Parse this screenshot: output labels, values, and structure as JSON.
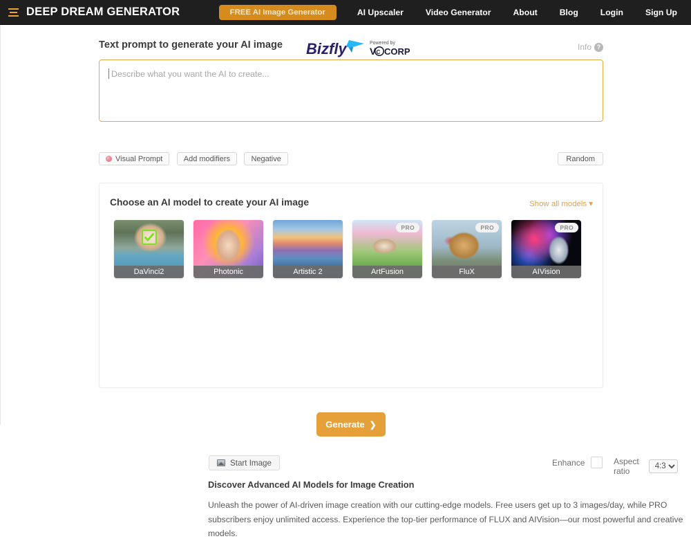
{
  "nav": {
    "menu_icon": "hamburger-icon",
    "brand": "DEEP DREAM GENERATOR",
    "cta": "FREE AI Image Generator",
    "links": [
      {
        "label": "AI Upscaler"
      },
      {
        "label": "Video Generator"
      },
      {
        "label": "About"
      },
      {
        "label": "Blog"
      },
      {
        "label": "Login"
      },
      {
        "label": "Sign Up"
      }
    ],
    "cta_color": "#d68c1c",
    "bar_color": "#1f1f1f"
  },
  "prompt": {
    "title": "Text prompt to generate your AI image",
    "placeholder": "Describe what you want the AI to create...",
    "value": "",
    "info_label": "Info",
    "info_icon": "question-mark-icon",
    "border_color": "#e0a94a",
    "sponsor": {
      "brand": "Bizfly",
      "powered_by": "Powered by",
      "parent": "CCORP",
      "parent_prefix": "V",
      "brand_color": "#2b1f6b",
      "accent_color": "#29b6f6"
    },
    "tools": [
      {
        "label": "Visual Prompt",
        "icon": "visual-prompt-icon"
      },
      {
        "label": "Add modifiers",
        "icon": null
      },
      {
        "label": "Negative",
        "icon": null
      }
    ],
    "random_label": "Random"
  },
  "models": {
    "panel_title": "Choose an AI model to create your AI image",
    "show_all_label": "Show all models",
    "show_all_icon": "chevron-down-icon",
    "show_all_color": "#dba34f",
    "items": [
      {
        "name": "DaVinci2",
        "pro": false,
        "selected": true,
        "thumb": "t-davinci"
      },
      {
        "name": "Photonic",
        "pro": false,
        "selected": false,
        "thumb": "t-photonic"
      },
      {
        "name": "Artistic 2",
        "pro": false,
        "selected": false,
        "thumb": "t-artistic"
      },
      {
        "name": "ArtFusion",
        "pro": true,
        "selected": false,
        "thumb": "t-artfusion"
      },
      {
        "name": "FluX",
        "pro": true,
        "selected": false,
        "thumb": "t-flux"
      },
      {
        "name": "AIVision",
        "pro": true,
        "selected": false,
        "thumb": "t-aivision"
      }
    ],
    "pro_badge_label": "PRO",
    "selected_icon": "check-mark-icon"
  },
  "controls": {
    "start_image_label": "Start Image",
    "start_image_icon": "image-icon",
    "enhance_label": "Enhance",
    "enhance_checked": false,
    "aspect_ratio_label": "Aspect ratio",
    "aspect_ratio_value": "4:3",
    "aspect_ratio_options": [
      "4:3"
    ]
  },
  "discover": {
    "title": "Discover Advanced AI Models for Image Creation",
    "body": "Unleash the power of AI-driven image creation with our cutting-edge models. Free users get up to 3 images/day, while PRO subscribers enjoy unlimited access. Experience the top-tier performance of FLUX and AIVision—our most powerful and creative models."
  },
  "generate": {
    "label": "Generate",
    "icon": "chevron-right-icon",
    "color": "#e6a03a"
  }
}
